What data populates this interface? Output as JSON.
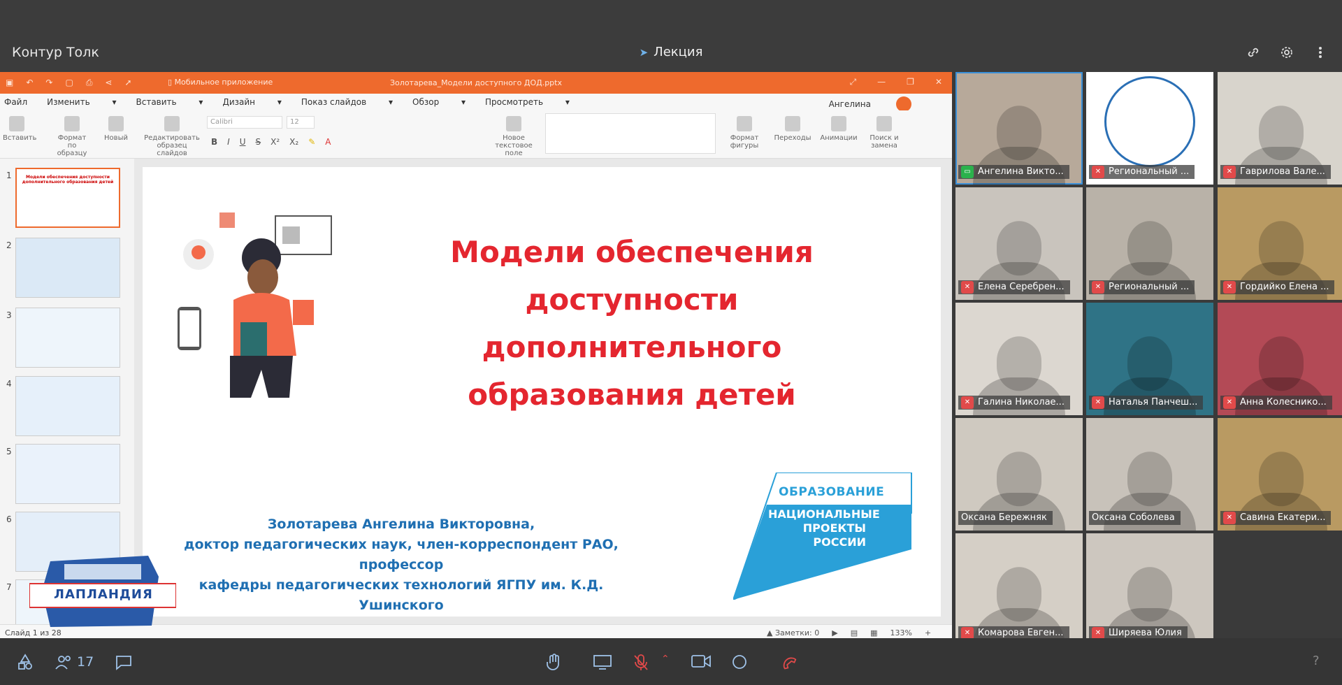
{
  "app": {
    "title": "Контур Толк",
    "meeting_title": "Лекция"
  },
  "ppt": {
    "file_name": "Золотарева_Модели доступного ДОД.pptx",
    "mobile_app": "Мобильное приложение",
    "menu": [
      "Файл",
      "Изменить",
      "Вставить",
      "Дизайн",
      "Показ слайдов",
      "Обзор",
      "Просмотреть"
    ],
    "user": "Ангелина",
    "ribbon": {
      "paste": "Вставить",
      "format_sample": "Формат по образцу",
      "new": "Новый",
      "edit_master": "Редактировать образец слайдов",
      "font": "Calibri",
      "size": "12",
      "new_textbox": "Новое текстовое поле",
      "shape_format": "Формат фигуры",
      "transitions": "Переходы",
      "animations": "Анимации",
      "find_replace": "Поиск и замена"
    },
    "thumb_numbers": [
      "1",
      "2",
      "3",
      "4",
      "5",
      "6",
      "7"
    ],
    "thumb1_title": "Модели обеспечения доступности дополнительного образования детей",
    "status": {
      "slide_of": "Слайд 1 из 28",
      "notes": "Заметки: 0",
      "zoom": "133%"
    }
  },
  "slide": {
    "title_lines": [
      "Модели обеспечения",
      "доступности",
      "дополнительного",
      "образования детей"
    ],
    "author_lines": [
      "Золотарева Ангелина Викторовна,",
      "доктор педагогических наук, член-корреспондент РАО, профессор",
      "кафедры педагогических технологий ЯГПУ им. К.Д. Ушинского"
    ],
    "logo_top": "ОБРАЗОВАНИЕ",
    "logo_lines": [
      "НАЦИОНАЛЬНЫЕ",
      "ПРОЕКТЫ",
      "РОССИИ"
    ]
  },
  "watermark": {
    "text": "ЛАПЛАНДИЯ"
  },
  "participants": [
    {
      "name": "Ангелина Викто...",
      "mic": "screen",
      "bg": "#b7a99a"
    },
    {
      "name": "Региональный ...",
      "mic": "muted",
      "bg": "#ffffff"
    },
    {
      "name": "Гаврилова Вале...",
      "mic": "muted",
      "bg": "#d8d4cc"
    },
    {
      "name": "Елена Серебрен...",
      "mic": "muted",
      "bg": "#c9c4bd"
    },
    {
      "name": "Региональный ...",
      "mic": "muted",
      "bg": "#b9b2a8"
    },
    {
      "name": "Гордийко Елена ...",
      "mic": "muted",
      "bg": "#b99a62"
    },
    {
      "name": "Галина Николае...",
      "mic": "muted",
      "bg": "#dcd7d0"
    },
    {
      "name": "Наталья Панчеш...",
      "mic": "muted",
      "bg": "#2f7386"
    },
    {
      "name": "Анна Колеснико...",
      "mic": "muted",
      "bg": "#b34a56"
    },
    {
      "name": "Оксана Бережняк",
      "mic": "none",
      "bg": "#cfc9c0"
    },
    {
      "name": "Оксана Соболева",
      "mic": "none",
      "bg": "#c8c2ba"
    },
    {
      "name": "Савина Екатери...",
      "mic": "muted",
      "bg": "#b99a62"
    },
    {
      "name": "Комарова Евген...",
      "mic": "muted",
      "bg": "#d5cfc6"
    },
    {
      "name": "Ширяева Юлия",
      "mic": "muted",
      "bg": "#cdc7bf"
    }
  ],
  "controls": {
    "participants_count": "17"
  },
  "colors": {
    "accent": "#ee6a2d",
    "slide_title": "#e4262f",
    "author": "#1f6fb2",
    "logo": "#2aa0d8",
    "muted": "#e14a4a"
  }
}
